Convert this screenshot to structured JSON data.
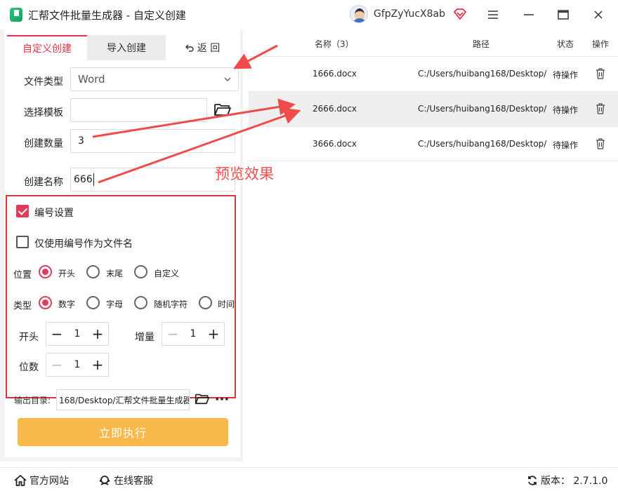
{
  "window": {
    "title": "汇帮文件批量生成器 - 自定义创建",
    "username": "GfpZyYucX8ab"
  },
  "tabs": {
    "custom": "自定义创建",
    "import": "导入创建",
    "back": "返 回"
  },
  "form": {
    "file_type_label": "文件类型",
    "file_type_value": "Word",
    "template_label": "选择模板",
    "template_value": "",
    "count_label": "创建数量",
    "count_value": "3",
    "name_label": "创建名称",
    "name_value": "666"
  },
  "numbering": {
    "enable_label": "编号设置",
    "enable_checked": true,
    "only_number_label": "仅使用编号作为文件名",
    "only_number_checked": false,
    "position_label": "位置",
    "position_options": [
      "开头",
      "末尾",
      "自定义"
    ],
    "position_selected": "开头",
    "type_label": "类型",
    "type_options": [
      "数字",
      "字母",
      "随机字符",
      "时间"
    ],
    "type_selected": "数字",
    "start_label": "开头",
    "start_value": "1",
    "increment_label": "增量",
    "increment_value": "1",
    "digits_label": "位数",
    "digits_value": "1"
  },
  "output": {
    "label": "输出目录:",
    "value": "168/Desktop/汇帮文件批量生成器"
  },
  "run_label": "立即执行",
  "table": {
    "headers": [
      "名称（3）",
      "路径",
      "状态",
      "操作"
    ],
    "rows": [
      {
        "name": "1666.docx",
        "path": "C:/Users/huibang168/Desktop/",
        "status": "待操作"
      },
      {
        "name": "2666.docx",
        "path": "C:/Users/huibang168/Desktop/",
        "status": "待操作"
      },
      {
        "name": "3666.docx",
        "path": "C:/Users/huibang168/Desktop/",
        "status": "待操作"
      }
    ],
    "selected_row": 1
  },
  "annotation": "预览效果",
  "footer": {
    "website": "官方网站",
    "support": "在线客服",
    "version": "版本： 2.7.1.0"
  },
  "colors": {
    "accent": "#e8334a",
    "run_button": "#f8b94a",
    "annotation": "#f05050"
  }
}
